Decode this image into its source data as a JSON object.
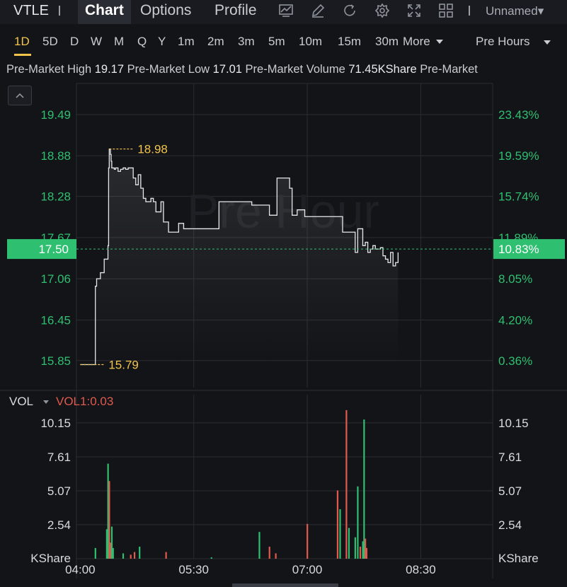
{
  "header": {
    "ticker": "VTLE",
    "tabs": [
      {
        "label": "Chart",
        "active": true
      },
      {
        "label": "Options",
        "active": false
      },
      {
        "label": "Profile",
        "active": false
      }
    ],
    "tools": [
      "chart-type-icon",
      "draw-icon",
      "refresh-icon",
      "settings-icon",
      "fullscreen-icon",
      "layout-grid-icon"
    ],
    "layout_name": "Unnamed▾"
  },
  "periods": {
    "items": [
      "1D",
      "5D",
      "D",
      "W",
      "M",
      "Q",
      "Y",
      "1m",
      "2m",
      "3m",
      "5m",
      "10m",
      "15m",
      "30m",
      "More"
    ],
    "active": "1D",
    "session": "Pre Hours"
  },
  "info": {
    "high_label": "Pre-Market High",
    "high_value": "19.17",
    "low_label": "Pre-Market Low",
    "low_value": "17.01",
    "volume_label": "Pre-Market Volume",
    "volume_value": "71.45KShare",
    "extra_label": "Pre-Market"
  },
  "colors": {
    "background": "#131418",
    "grid": "#2a2c31",
    "price_line": "#e6e7ea",
    "axis_text": "#2fbf71",
    "up": "#2fbf71",
    "down": "#e05a4e",
    "annotation": "#f2c44c",
    "current_tag": "#2fbf71"
  },
  "chart_data": [
    {
      "type": "line",
      "watermark": "Pre Hour",
      "y_ticks_left": [
        "19.49",
        "18.88",
        "18.28",
        "17.67",
        "17.06",
        "16.45",
        "15.85"
      ],
      "y_tick_values": [
        19.49,
        18.88,
        18.28,
        17.67,
        17.06,
        16.45,
        15.85
      ],
      "y_ticks_right": [
        "23.43%",
        "19.59%",
        "15.74%",
        "11.89%",
        "8.05%",
        "4.20%",
        "0.36%"
      ],
      "ylim": [
        15.45,
        19.95
      ],
      "x_ticks": [
        "04:00",
        "05:30",
        "07:00",
        "08:30"
      ],
      "x_tick_minutes": [
        0,
        90,
        180,
        270
      ],
      "xlim": [
        -3,
        327
      ],
      "current_price": "17.50",
      "current_pct": "10.83%",
      "current_value": 17.5,
      "annotations": [
        {
          "label": "18.98",
          "minute": 23,
          "value": 18.98
        },
        {
          "label": "15.79",
          "minute": 0,
          "value": 15.79
        }
      ],
      "series": [
        {
          "x": [
            0,
            5,
            9,
            10,
            12,
            13,
            16,
            19,
            22,
            22.5,
            23,
            24,
            24.5,
            25,
            26,
            27,
            28,
            30,
            32,
            34,
            36,
            38,
            40,
            42,
            44,
            46,
            48,
            50,
            52,
            54,
            56,
            58,
            60,
            62,
            64,
            66,
            68,
            70,
            74,
            78,
            82,
            86,
            90,
            94,
            98,
            102,
            106,
            108,
            110,
            114,
            118,
            124,
            128,
            132,
            136,
            140,
            142,
            146,
            150,
            152,
            154,
            156,
            158,
            160,
            162,
            164,
            166,
            168,
            172,
            178,
            184,
            190,
            196,
            200,
            202,
            204,
            206,
            208,
            210,
            212,
            216,
            218,
            220,
            224,
            226,
            228,
            230,
            232,
            234,
            236,
            238,
            240,
            242,
            244,
            246,
            248,
            250,
            252
          ],
          "y": [
            15.79,
            15.79,
            15.79,
            15.79,
            16.95,
            17.06,
            17.15,
            17.35,
            17.55,
            18.7,
            18.98,
            18.9,
            18.8,
            18.7,
            18.7,
            18.68,
            18.7,
            18.65,
            18.68,
            18.7,
            18.68,
            18.7,
            18.7,
            18.55,
            18.45,
            18.6,
            18.4,
            18.25,
            18.2,
            18.2,
            18.25,
            18.2,
            18.05,
            18.05,
            18.2,
            17.9,
            17.9,
            17.75,
            17.75,
            17.88,
            17.8,
            17.8,
            17.8,
            17.8,
            17.8,
            17.8,
            17.8,
            17.8,
            18.2,
            18.2,
            18.2,
            18.2,
            18.2,
            18.2,
            18.15,
            18.15,
            18.15,
            18.15,
            18.0,
            18.0,
            18.0,
            18.55,
            18.55,
            18.55,
            18.55,
            18.55,
            18.4,
            18.0,
            18.08,
            17.98,
            17.98,
            17.98,
            17.98,
            17.98,
            17.98,
            17.98,
            17.98,
            17.75,
            17.75,
            17.75,
            17.75,
            17.45,
            17.8,
            17.55,
            17.6,
            17.45,
            17.5,
            17.55,
            17.5,
            17.5,
            17.52,
            17.4,
            17.35,
            17.3,
            17.45,
            17.25,
            17.3,
            17.45
          ]
        }
      ]
    },
    {
      "type": "bar",
      "indicator": "VOL",
      "indicator_value": "VOL1:0.03",
      "unit": "KShare",
      "y_ticks": [
        "10.15",
        "7.61",
        "5.07",
        "2.54"
      ],
      "y_tick_values": [
        10.15,
        7.61,
        5.07,
        2.54
      ],
      "ylim": [
        0,
        11.2
      ],
      "xlim": [
        -3,
        327
      ],
      "x_ticks": [
        "04:00",
        "05:30",
        "07:00",
        "08:30"
      ],
      "x_tick_minutes": [
        0,
        90,
        180,
        270
      ],
      "bars": [
        {
          "minute": 12,
          "value": 0.8,
          "dir": "up"
        },
        {
          "minute": 21,
          "value": 2.2,
          "dir": "up"
        },
        {
          "minute": 22,
          "value": 7.1,
          "dir": "up"
        },
        {
          "minute": 23,
          "value": 5.8,
          "dir": "down"
        },
        {
          "minute": 24,
          "value": 1.2,
          "dir": "down"
        },
        {
          "minute": 25,
          "value": 2.4,
          "dir": "up"
        },
        {
          "minute": 26,
          "value": 0.8,
          "dir": "up"
        },
        {
          "minute": 34,
          "value": 0.4,
          "dir": "up"
        },
        {
          "minute": 40,
          "value": 0.3,
          "dir": "down"
        },
        {
          "minute": 43,
          "value": 0.5,
          "dir": "down"
        },
        {
          "minute": 47,
          "value": 0.9,
          "dir": "up"
        },
        {
          "minute": 68,
          "value": 0.5,
          "dir": "down"
        },
        {
          "minute": 104,
          "value": 0.1,
          "dir": "up"
        },
        {
          "minute": 142,
          "value": 2.0,
          "dir": "up"
        },
        {
          "minute": 150,
          "value": 0.9,
          "dir": "down"
        },
        {
          "minute": 155,
          "value": 0.4,
          "dir": "down"
        },
        {
          "minute": 180,
          "value": 2.6,
          "dir": "down"
        },
        {
          "minute": 204,
          "value": 5.1,
          "dir": "down"
        },
        {
          "minute": 206,
          "value": 3.7,
          "dir": "up"
        },
        {
          "minute": 211,
          "value": 11.1,
          "dir": "down"
        },
        {
          "minute": 213,
          "value": 2.3,
          "dir": "up"
        },
        {
          "minute": 218,
          "value": 1.6,
          "dir": "up"
        },
        {
          "minute": 220,
          "value": 5.4,
          "dir": "up"
        },
        {
          "minute": 222,
          "value": 0.9,
          "dir": "down"
        },
        {
          "minute": 224,
          "value": 1.3,
          "dir": "up"
        },
        {
          "minute": 225,
          "value": 10.4,
          "dir": "up"
        },
        {
          "minute": 226,
          "value": 1.5,
          "dir": "down"
        },
        {
          "minute": 227,
          "value": 0.8,
          "dir": "down"
        }
      ]
    }
  ]
}
